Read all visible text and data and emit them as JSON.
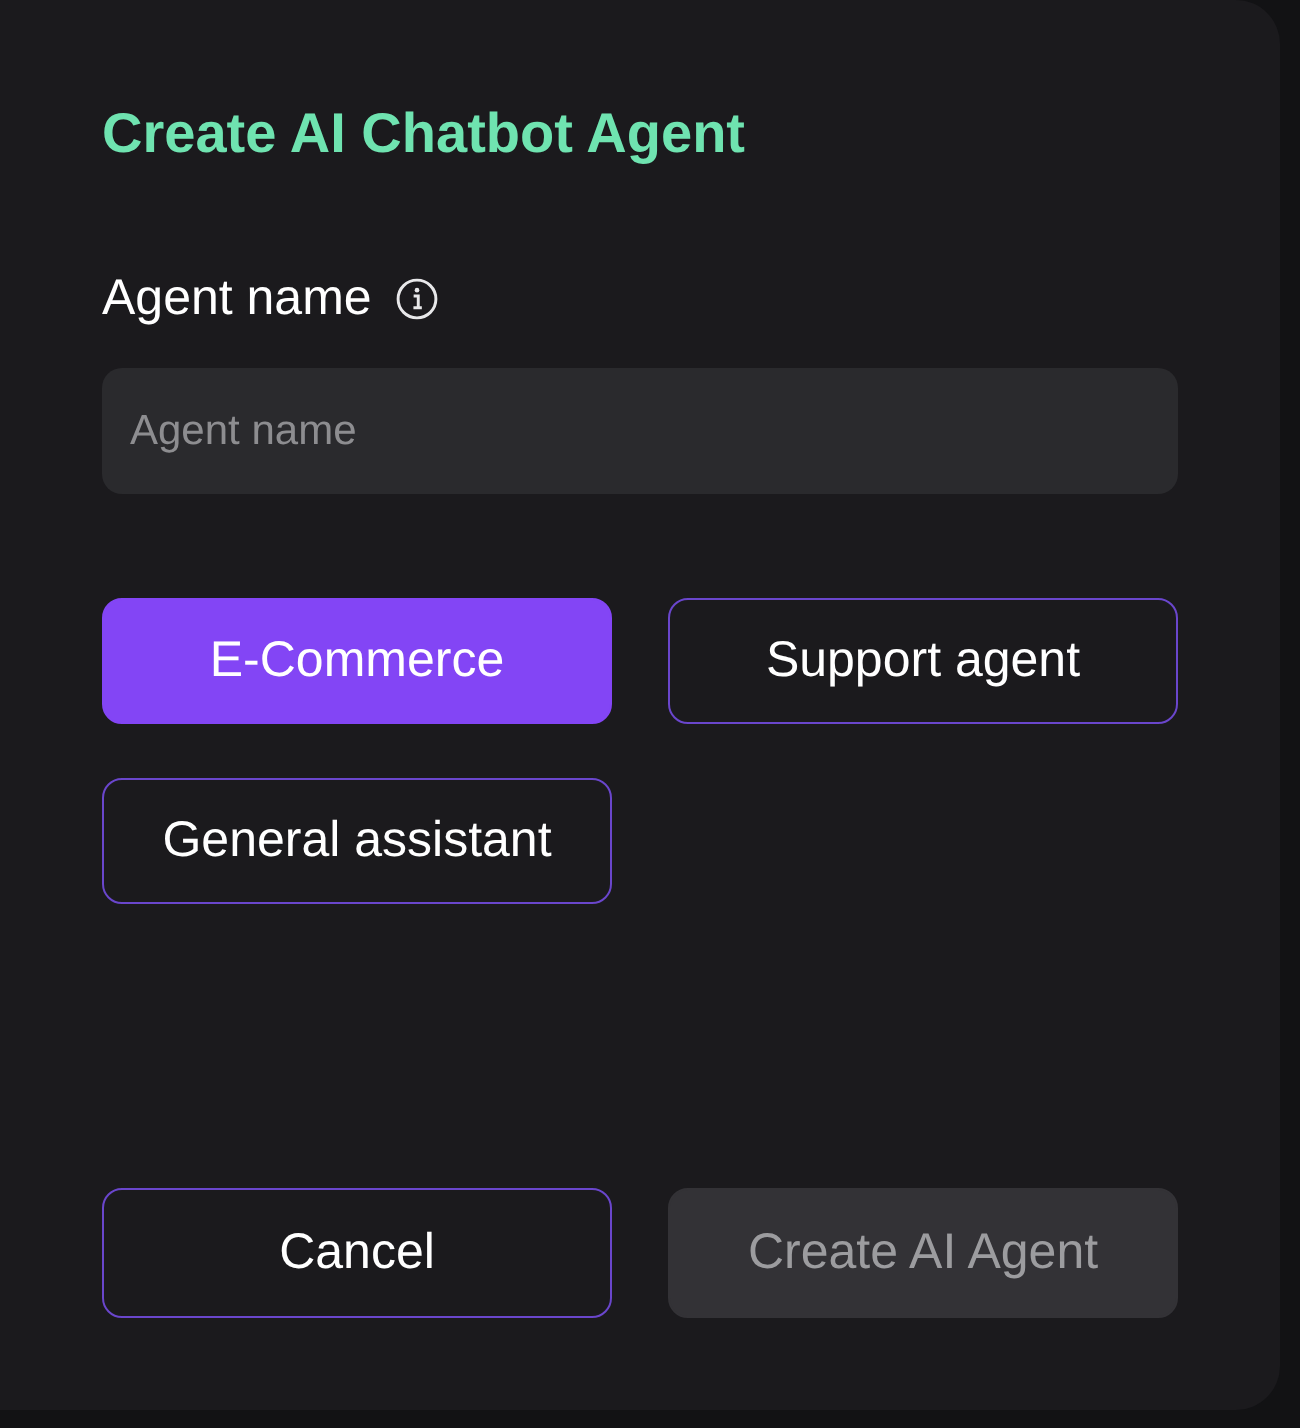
{
  "dialog": {
    "title": "Create AI Chatbot Agent"
  },
  "agent_name": {
    "label": "Agent name",
    "placeholder": "Agent name"
  },
  "templates": [
    {
      "label": "E-Commerce",
      "selected": true
    },
    {
      "label": "Support agent",
      "selected": false
    },
    {
      "label": "General assistant",
      "selected": false
    }
  ],
  "buttons": [
    {
      "label": "Cancel",
      "kind": "secondary",
      "disabled": false
    },
    {
      "label": "Create AI Agent",
      "kind": "primary",
      "disabled": true
    }
  ]
}
